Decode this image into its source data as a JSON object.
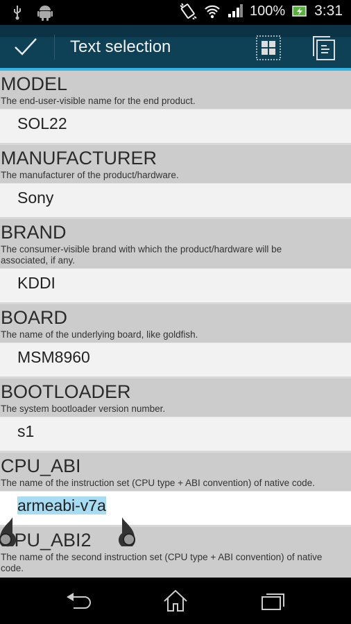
{
  "status_bar": {
    "left_icons": [
      "usb-icon",
      "android-debug-icon"
    ],
    "right_icons": [
      "vibrate-icon",
      "wifi-icon",
      "signal-icon"
    ],
    "battery_percent": "100%",
    "battery_icon": "battery-charging-icon",
    "time": "3:31"
  },
  "action_bar": {
    "done_icon": "checkmark-icon",
    "title": "Text selection",
    "select_all_icon": "select-all-icon",
    "copy_icon": "copy-icon",
    "accent_color": "#33b5e5"
  },
  "items": [
    {
      "name": "MODEL",
      "description": "The end-user-visible name for the end product.",
      "value": "SOL22"
    },
    {
      "name": "MANUFACTURER",
      "description": "The manufacturer of the product/hardware.",
      "value": "Sony"
    },
    {
      "name": "BRAND",
      "description": "The consumer-visible brand with which the product/hardware will be associated, if any.",
      "value": "KDDI"
    },
    {
      "name": "BOARD",
      "description": "The name of the underlying board, like goldfish.",
      "value": "MSM8960"
    },
    {
      "name": "BOOTLOADER",
      "description": "The system bootloader version number.",
      "value": "s1"
    },
    {
      "name": "CPU_ABI",
      "description": "The name of the instruction set (CPU type + ABI convention) of native code.",
      "value": "armeabi-v7a",
      "selected": true
    },
    {
      "name": "CPU_ABI2",
      "description": "The name of the second instruction set (CPU type + ABI convention) of native code.",
      "value": ""
    }
  ],
  "selection": {
    "text": "armeabi-v7a",
    "highlight_color": "#a7dcf2"
  },
  "nav_bar": {
    "back_icon": "back-icon",
    "home_icon": "home-icon",
    "recents_icon": "recents-icon"
  }
}
